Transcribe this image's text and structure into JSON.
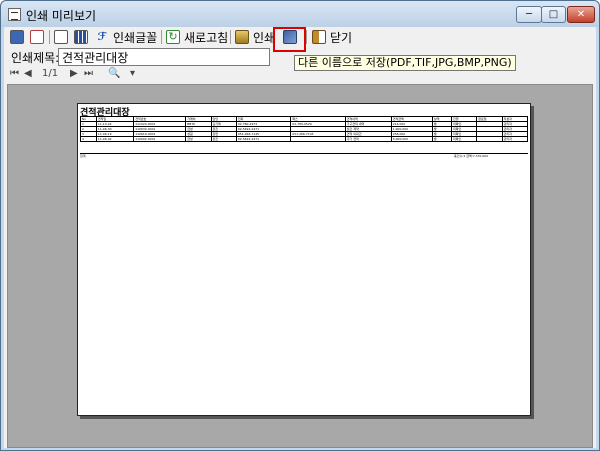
{
  "window": {
    "title": "인쇄 미리보기",
    "min": "─",
    "max": "□",
    "close": "✕"
  },
  "toolbar": {
    "font_label": "인쇄글꼴",
    "refresh_label": "새로고침",
    "print_label": "인쇄",
    "close_label": "닫기",
    "tooltip": "다른 이름으로 저장(PDF,TIF,JPG,BMP,PNG)"
  },
  "print_title": {
    "label": "인쇄제목:",
    "value": "견적관리대장"
  },
  "nav": {
    "first": "⏮",
    "prev": "◀",
    "page": "1/1",
    "next": "▶",
    "last": "⏭",
    "zoom": "🔍",
    "zoom_dropdown": "▾"
  },
  "report": {
    "title": "견적관리대장",
    "headers": [
      "No",
      "견적일",
      "견적번호",
      "거래처",
      "담당",
      "전화",
      "팩스",
      "견적내역",
      "견적금액",
      "상태",
      "진행",
      "완료일",
      "작성자"
    ],
    "rows": [
      [
        "1",
        "11-10-24",
        "111024-0001",
        "BBTK",
        "김기택",
        "02-780-2973",
        "02-780-0529",
        "가구견적 내역",
        "214,000",
        "발",
        "미확인",
        "",
        "관리자"
      ],
      [
        "2",
        "11-06-30",
        "110630-0001",
        "금성",
        "장진",
        "02-5492-2471",
        "",
        "월간 계약",
        "1,900,000",
        "발",
        "미확인",
        "",
        "관리자"
      ],
      [
        "3",
        "11-06-19",
        "110619-0001",
        "성림",
        "장현",
        "051-266-7145",
        "051-266-7145",
        "견적 의뢰건",
        "256,000",
        "발",
        "미확인",
        "",
        "관리자"
      ],
      [
        "4",
        "11-06-02",
        "110602-0001",
        "금성",
        "장진",
        "02-5492-2471",
        "",
        "추가 견적",
        "5,000,000",
        "발",
        "미확인",
        "",
        "관리자"
      ]
    ],
    "total_label": "합계",
    "total_value": "총건수:4  금액:7,370,000"
  }
}
